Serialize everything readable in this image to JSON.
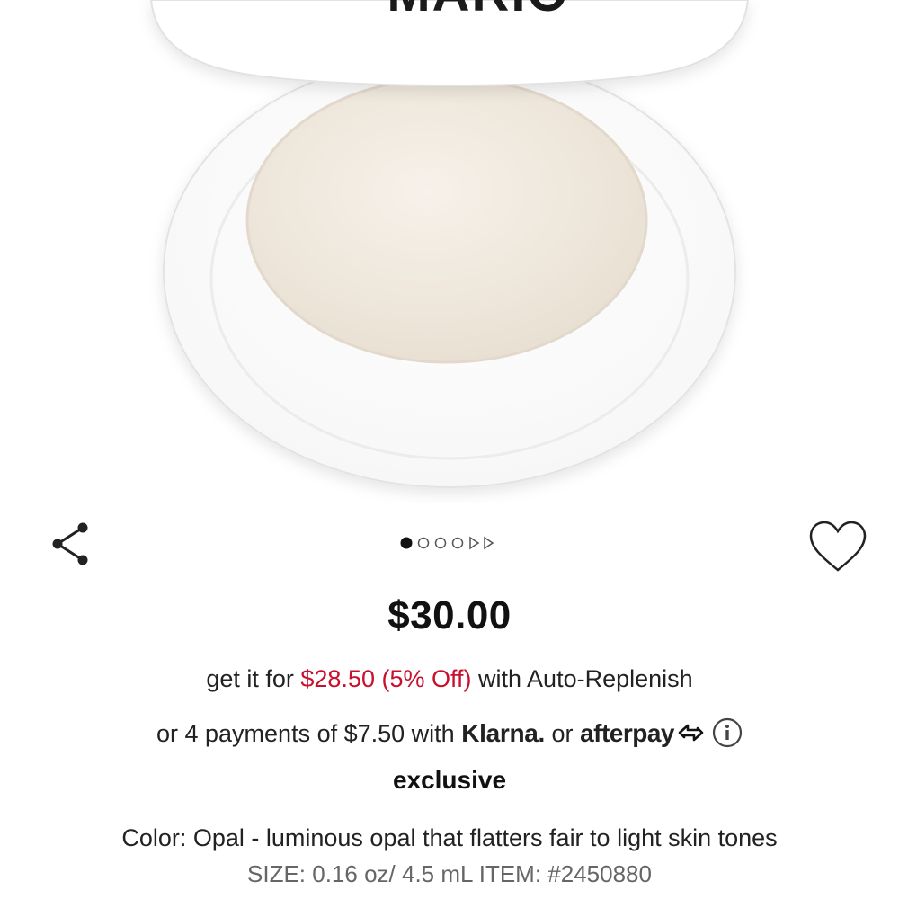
{
  "product": {
    "brand_text": "MARIO",
    "price": "$30.00",
    "replenish": {
      "prefix": "get it for",
      "discount": "$28.50 (5% Off)",
      "suffix": "with Auto-Replenish"
    },
    "payments": {
      "prefix": "or 4 payments of $7.50 with",
      "klarna": "Klarna.",
      "or": "or",
      "afterpay": "afterpay"
    },
    "badge": "exclusive",
    "color_line": "Color: Opal - luminous opal that flatters fair to light skin tones",
    "size_line": "SIZE: 0.16 oz/ 4.5 mL ITEM: #2450880"
  },
  "carousel": {
    "active_index": 1,
    "dot_count": 4,
    "arrow_count": 2
  },
  "icons": {
    "share": "share-icon",
    "wishlist": "heart-outline-icon",
    "info": "info-icon",
    "afterpay_logo": "afterpay-loop-icon"
  },
  "colors": {
    "accent_red": "#c8102e",
    "text_dark": "#111111",
    "text_muted": "#666666",
    "powder": "#efe7dc"
  }
}
